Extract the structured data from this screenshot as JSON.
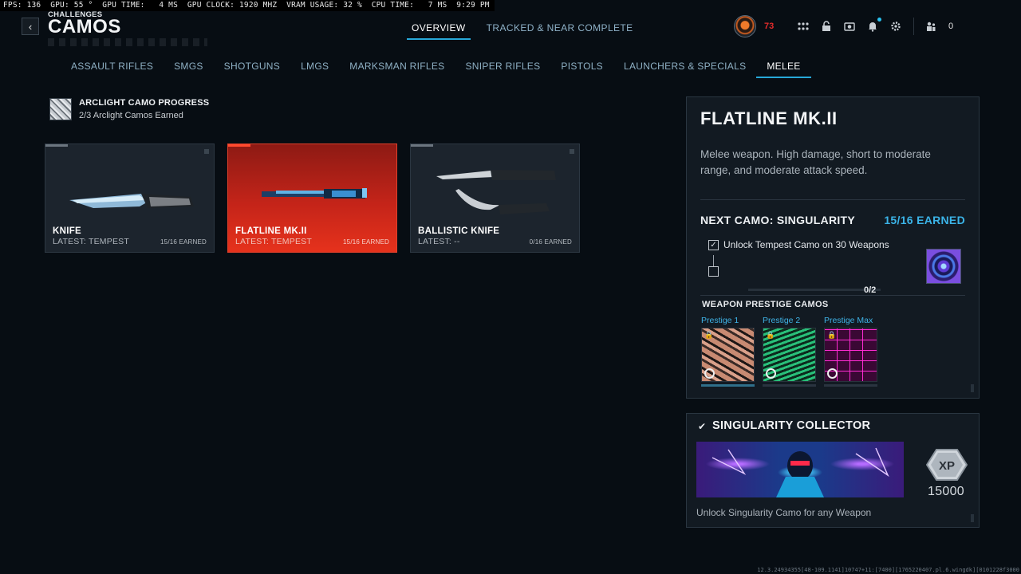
{
  "perf_overlay": "FPS: 136  GPU: 55 °  GPU TIME:   4 MS  GPU CLOCK: 1920 MHZ  VRAM USAGE: 32 %  CPU TIME:   7 MS  9:29 PM",
  "header": {
    "breadcrumb": "CHALLENGES",
    "title": "CAMOS",
    "back_icon": "chevron-left-icon"
  },
  "top_tabs": [
    {
      "label": "OVERVIEW",
      "active": true
    },
    {
      "label": "TRACKED & NEAR COMPLETE",
      "active": false
    }
  ],
  "hud": {
    "level": "73",
    "currency": "0",
    "icons": [
      "grid-icon",
      "unlock-icon",
      "camera-icon",
      "bell-icon",
      "settings-icon",
      "party-icon"
    ]
  },
  "categories": [
    {
      "label": "ASSAULT RIFLES",
      "active": false
    },
    {
      "label": "SMGS",
      "active": false
    },
    {
      "label": "SHOTGUNS",
      "active": false
    },
    {
      "label": "LMGS",
      "active": false
    },
    {
      "label": "MARKSMAN RIFLES",
      "active": false
    },
    {
      "label": "SNIPER RIFLES",
      "active": false
    },
    {
      "label": "PISTOLS",
      "active": false
    },
    {
      "label": "LAUNCHERS & SPECIALS",
      "active": false
    },
    {
      "label": "MELEE",
      "active": true
    }
  ],
  "arclight": {
    "title": "ARCLIGHT CAMO PROGRESS",
    "subtitle": "2/3 Arclight Camos Earned"
  },
  "weapons": [
    {
      "name": "KNIFE",
      "latest": "LATEST: TEMPEST",
      "earned": "15/16 EARNED",
      "selected": false
    },
    {
      "name": "FLATLINE MK.II",
      "latest": "LATEST: TEMPEST",
      "earned": "15/16 EARNED",
      "selected": true
    },
    {
      "name": "BALLISTIC KNIFE",
      "latest": "LATEST: --",
      "earned": "0/16 EARNED",
      "selected": false
    }
  ],
  "detail": {
    "title": "FLATLINE MK.II",
    "description": "Melee weapon. High damage, short to moderate range, and moderate attack speed.",
    "next_camo_label": "NEXT CAMO: SINGULARITY",
    "next_camo_earned": "15/16 EARNED",
    "task": "Unlock Tempest Camo on 30 Weapons",
    "task_progress": "0/2",
    "prestige_header": "WEAPON PRESTIGE CAMOS",
    "prestige": [
      {
        "label": "Prestige 1"
      },
      {
        "label": "Prestige 2"
      },
      {
        "label": "Prestige Max"
      }
    ]
  },
  "reward": {
    "title": "SINGULARITY COLLECTOR",
    "xp_label": "XP",
    "xp_amount": "15000",
    "description": "Unlock Singularity Camo for any Weapon"
  },
  "build_string": "12.3.24934355[48-109.1141]10747+11:[7400][1765220407.pl.6.wingdk][0101228f3000"
}
